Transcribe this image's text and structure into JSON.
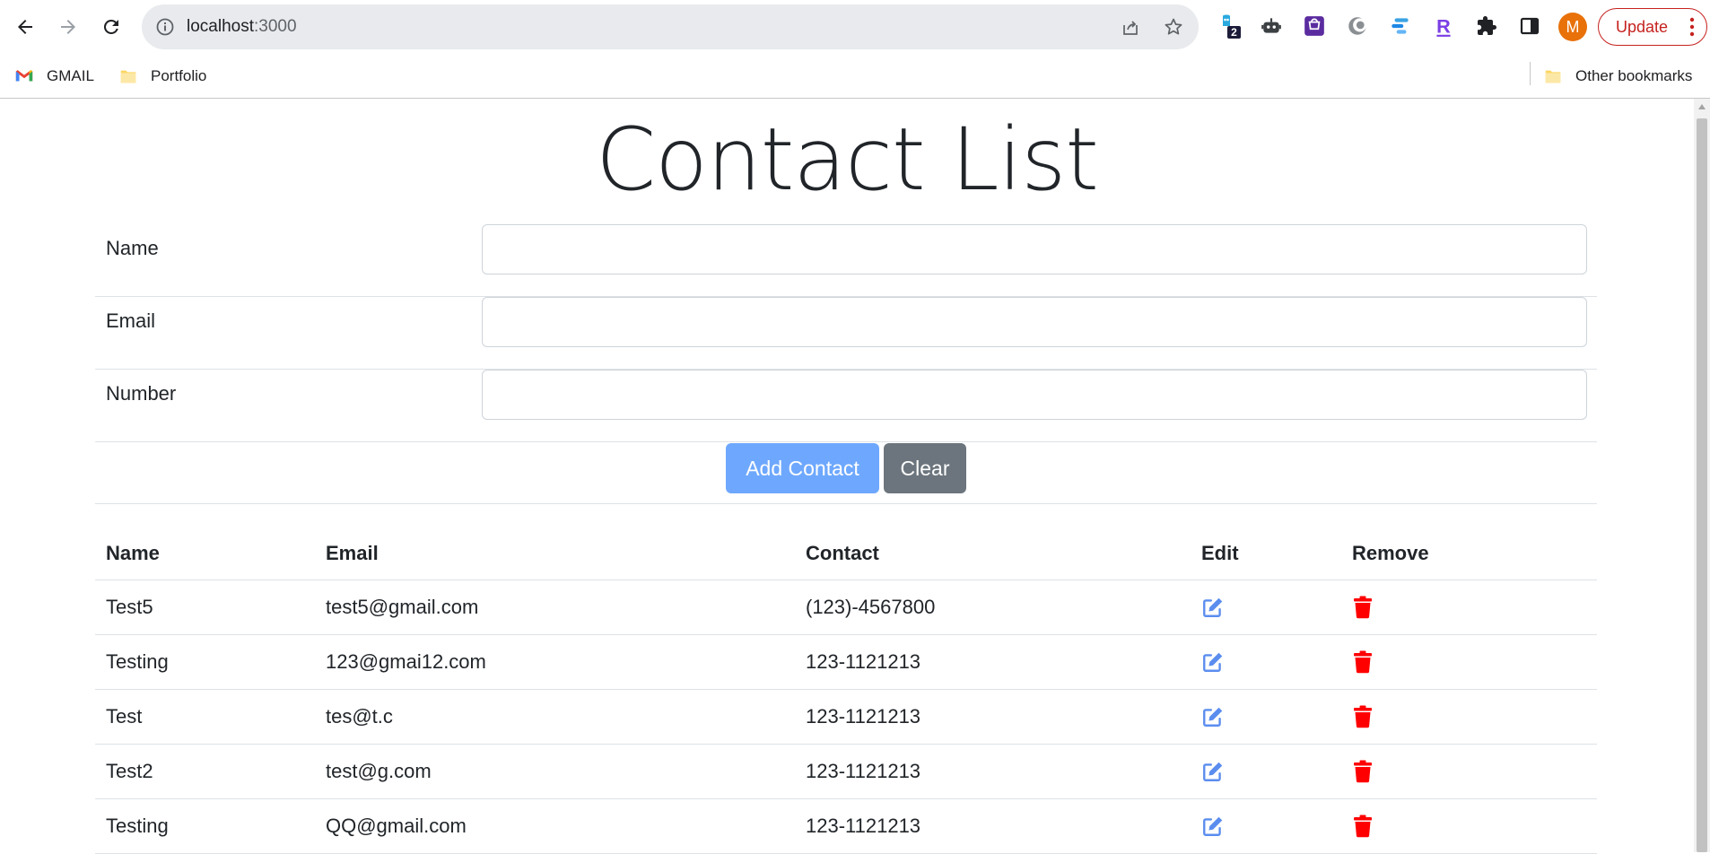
{
  "browser": {
    "url_host": "localhost",
    "url_port": ":3000",
    "update_label": "Update",
    "avatar_initial": "M",
    "extension_badge": "2"
  },
  "bookmarks": {
    "items": [
      {
        "label": "GMAIL",
        "icon": "gmail-icon"
      },
      {
        "label": "Portfolio",
        "icon": "folder-icon"
      }
    ],
    "other": "Other bookmarks"
  },
  "page": {
    "title": "Contact List"
  },
  "form": {
    "name_label": "Name",
    "email_label": "Email",
    "number_label": "Number",
    "name_value": "",
    "email_value": "",
    "number_value": "",
    "add_label": "Add Contact",
    "clear_label": "Clear"
  },
  "table": {
    "headers": [
      "Name",
      "Email",
      "Contact",
      "Edit",
      "Remove"
    ],
    "rows": [
      {
        "name": "Test5",
        "email": "test5@gmail.com",
        "contact": "(123)-4567800"
      },
      {
        "name": "Testing",
        "email": "123@gmai12.com",
        "contact": "123-1121213"
      },
      {
        "name": "Test",
        "email": "tes@t.c",
        "contact": "123-1121213"
      },
      {
        "name": "Test2",
        "email": "test@g.com",
        "contact": "123-1121213"
      },
      {
        "name": "Testing",
        "email": "QQ@gmail.com",
        "contact": "123-1121213"
      }
    ]
  },
  "colors": {
    "edit_icon": "#5b8def",
    "remove_icon": "#ff0000",
    "add_button": "#6ea8fe",
    "clear_button": "#6c757d"
  }
}
